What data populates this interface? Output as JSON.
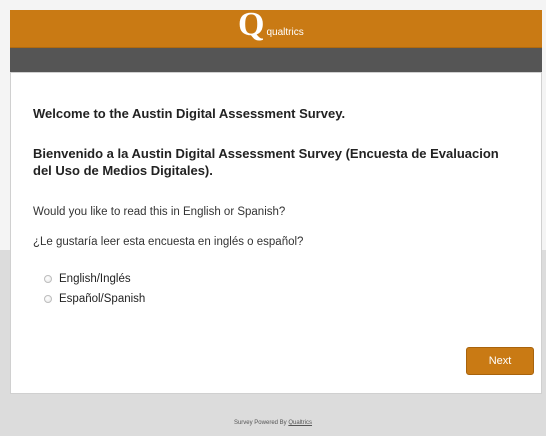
{
  "header": {
    "logo_letter": "Q",
    "logo_text": "qualtrics",
    "accent_color": "#c97a14",
    "bar_color": "#555555"
  },
  "survey": {
    "welcome_en": "Welcome to the Austin Digital Assessment Survey.",
    "welcome_es": "Bienvenido a la Austin Digital Assessment Survey (Encuesta de Evaluacion del Uso de Medios Digitales).",
    "question_en": "Would you like to read this in English or Spanish?",
    "question_es": "¿Le gustaría leer esta encuesta en inglés o español?",
    "options": [
      {
        "label": "English/Inglés"
      },
      {
        "label": "Español/Spanish"
      }
    ],
    "next_label": "Next"
  },
  "footer": {
    "text": "Survey Powered By",
    "link": "Qualtrics"
  }
}
